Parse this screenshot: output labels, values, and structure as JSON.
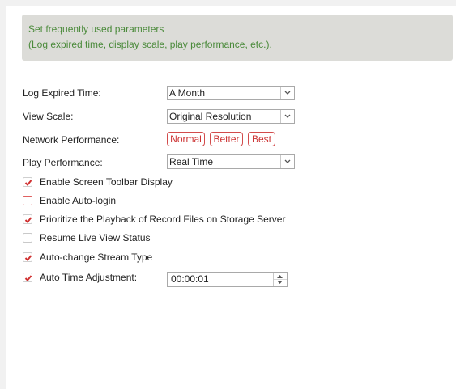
{
  "banner": {
    "line1": "Set frequently used parameters",
    "line2": "(Log expired time, display scale, play performance, etc.)."
  },
  "log_expired": {
    "label": "Log Expired Time:",
    "value": "A Month"
  },
  "view_scale": {
    "label": "View Scale:",
    "value": "Original Resolution"
  },
  "network_performance": {
    "label": "Network Performance:",
    "options": [
      "Normal",
      "Better",
      "Best"
    ]
  },
  "play_performance": {
    "label": "Play Performance:",
    "value": "Real Time"
  },
  "checkboxes": [
    {
      "label": "Enable Screen Toolbar Display",
      "checked": true
    },
    {
      "label": "Enable Auto-login",
      "checked": false
    },
    {
      "label": "Prioritize the Playback of Record Files on Storage Server",
      "checked": true
    },
    {
      "label": "Resume Live View Status",
      "checked": false
    },
    {
      "label": "Auto-change Stream Type",
      "checked": true
    },
    {
      "label": "Auto Time Adjustment:",
      "checked": true
    }
  ],
  "auto_time": {
    "value": "00:00:01"
  },
  "colors": {
    "accent": "#d24b4b",
    "banner_text": "#4a8a3a",
    "banner_bg": "#dcdcd8"
  },
  "icons": {
    "dropdown": "chevron-down-icon",
    "check": "check-icon",
    "spinner": "spinner-arrows-icon"
  }
}
